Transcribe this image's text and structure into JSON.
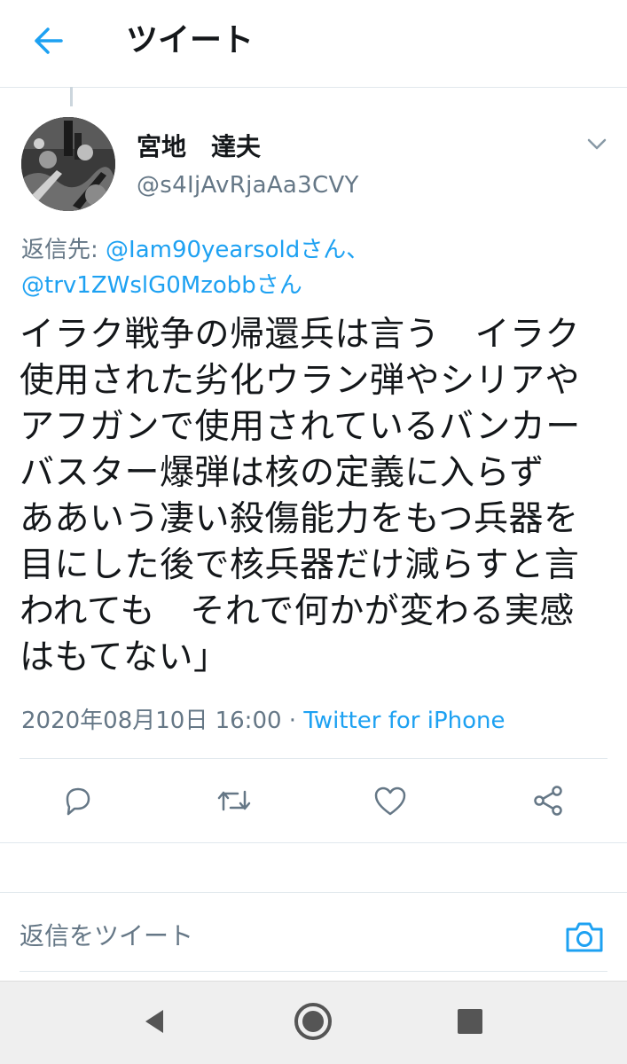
{
  "header": {
    "title": "ツイート",
    "back_icon": "arrow-left-icon"
  },
  "author": {
    "name": "宮地　達夫",
    "handle": "@s4IjAvRjaAa3CVY"
  },
  "reply_to": {
    "prefix": "返信先: ",
    "mention1": "@Iam90yearsoldさん、",
    "mention2": "@trv1ZWslG0Mzobbさん"
  },
  "tweet": {
    "text": "イラク戦争の帰還兵は言う　イラク使用された劣化ウラン弾やシリアやアフガンで使用されているバンカーバスター爆弾は核の定義に入らず　　ああいう凄い殺傷能力をもつ兵器を目にした後で核兵器だけ減らすと言われても　それで何かが変わる実感はもてない」",
    "timestamp": "2020年08月10日 16:00",
    "separator": " · ",
    "source": "Twitter for iPhone"
  },
  "actions": {
    "reply_icon": "reply-icon",
    "retweet_icon": "retweet-icon",
    "like_icon": "heart-icon",
    "share_icon": "share-icon"
  },
  "reply_bar": {
    "placeholder": "返信をツイート",
    "camera_icon": "camera-icon"
  },
  "colors": {
    "accent": "#1da1f2",
    "secondary_text": "#657786",
    "primary_text": "#14171a",
    "divider": "#e1e8ed",
    "navbar_bg": "#efefef"
  }
}
